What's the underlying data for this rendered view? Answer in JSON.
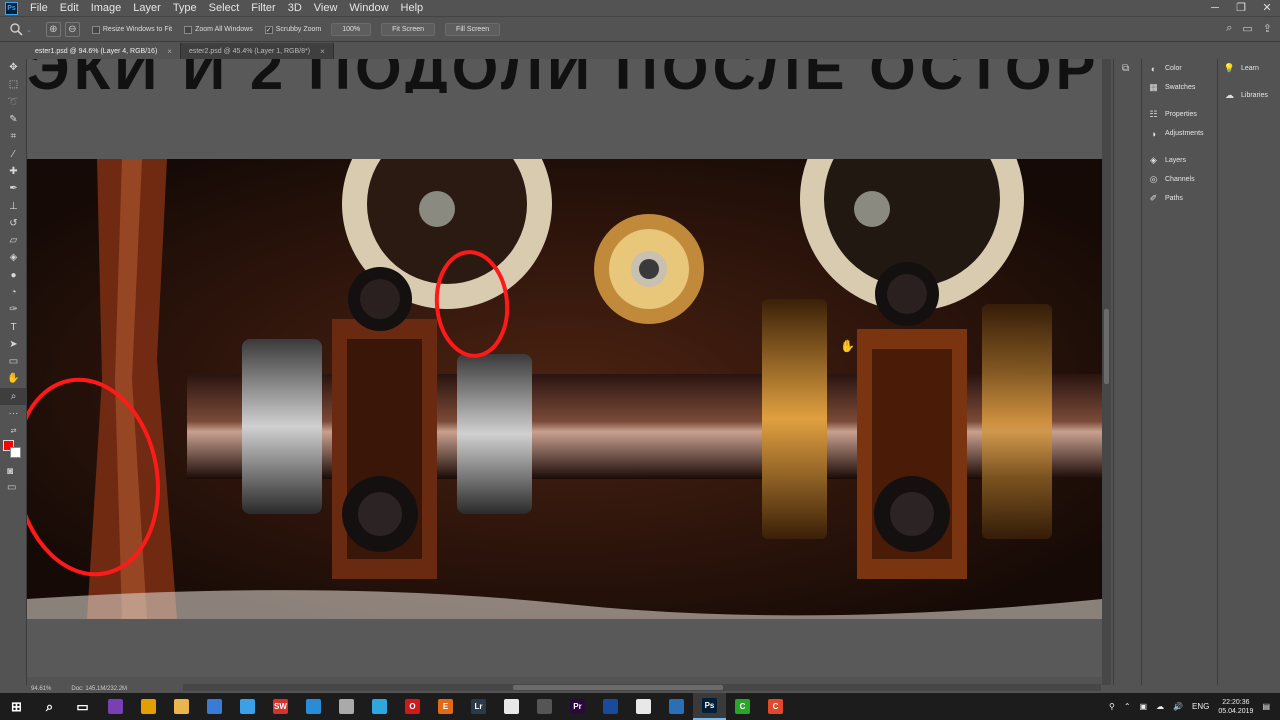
{
  "menubar": {
    "app_icon": "Ps",
    "items": [
      "File",
      "Edit",
      "Image",
      "Layer",
      "Type",
      "Select",
      "Filter",
      "3D",
      "View",
      "Window",
      "Help"
    ],
    "window_controls": [
      "minimize-icon",
      "restore-icon",
      "close-icon"
    ]
  },
  "options_bar": {
    "tool_icon": "zoom-icon",
    "checkboxes": [
      {
        "label": "Resize Windows to Fit",
        "checked": false
      },
      {
        "label": "Zoom All Windows",
        "checked": false
      },
      {
        "label": "Scrubby Zoom",
        "checked": true
      }
    ],
    "zoom_value": "100%",
    "fit_screen": "Fit Screen",
    "fill_screen": "Fill Screen"
  },
  "tabs": [
    {
      "label": "ester1.psd @ 94.6% (Layer 4, RGB/16)",
      "active": true
    },
    {
      "label": "ester2.psd @ 45.4% (Layer 1, RGB/8*)",
      "active": false
    }
  ],
  "canvas": {
    "headline": "ЭКИ И 2 ПОДОЛИ ПОСЛЕ ОСТОР"
  },
  "status": {
    "zoom": "94.61%",
    "doc": "Doc: 145.1M/232.2M"
  },
  "panels": {
    "col1": [
      "Color",
      "Swatches",
      "Properties",
      "Adjustments",
      "Layers",
      "Channels",
      "Paths"
    ],
    "col2": [
      "Learn",
      "Libraries"
    ]
  },
  "taskbar": {
    "clock_time": "22:20:36",
    "clock_date": "05.04.2019",
    "lang": "ENG",
    "apps": [
      {
        "name": "start-icon",
        "color": "#1c1c1c",
        "glyph": "⊞"
      },
      {
        "name": "search-icon",
        "color": "#1c1c1c",
        "glyph": "⌕"
      },
      {
        "name": "task-view-icon",
        "color": "#1c1c1c",
        "glyph": "▭"
      },
      {
        "name": "app-blocks-icon",
        "color": "#7a3fb0",
        "glyph": ""
      },
      {
        "name": "chrome-icon",
        "color": "#e0a000",
        "glyph": ""
      },
      {
        "name": "explorer-icon",
        "color": "#e8b64c",
        "glyph": ""
      },
      {
        "name": "save-icon",
        "color": "#3a7bd5",
        "glyph": ""
      },
      {
        "name": "edge-icon",
        "color": "#3aa0e8",
        "glyph": ""
      },
      {
        "name": "app-sw-icon",
        "color": "#d6312a",
        "glyph": "SW"
      },
      {
        "name": "store-icon",
        "color": "#2a8bd6",
        "glyph": ""
      },
      {
        "name": "app-cloud-icon",
        "color": "#aaaaaa",
        "glyph": ""
      },
      {
        "name": "telegram-icon",
        "color": "#2ea6de",
        "glyph": ""
      },
      {
        "name": "opera-icon",
        "color": "#d01a1a",
        "glyph": "O"
      },
      {
        "name": "app-e-icon",
        "color": "#e06a1a",
        "glyph": "E"
      },
      {
        "name": "lightroom-icon",
        "color": "#2b3a4a",
        "glyph": "Lr"
      },
      {
        "name": "document-icon",
        "color": "#e8e8e8",
        "glyph": ""
      },
      {
        "name": "app-shield-icon",
        "color": "#555555",
        "glyph": ""
      },
      {
        "name": "premiere-icon",
        "color": "#2a0a3a",
        "glyph": "Pr"
      },
      {
        "name": "app-screen-icon",
        "color": "#1a4a9a",
        "glyph": ""
      },
      {
        "name": "document2-icon",
        "color": "#e8e8e8",
        "glyph": ""
      },
      {
        "name": "app-x-icon",
        "color": "#2b6fb5",
        "glyph": ""
      },
      {
        "name": "photoshop-icon",
        "color": "#001e36",
        "glyph": "Ps"
      },
      {
        "name": "camtasia-icon",
        "color": "#2ca42c",
        "glyph": "C"
      },
      {
        "name": "app-c-icon",
        "color": "#e04a2a",
        "glyph": "C"
      }
    ]
  }
}
